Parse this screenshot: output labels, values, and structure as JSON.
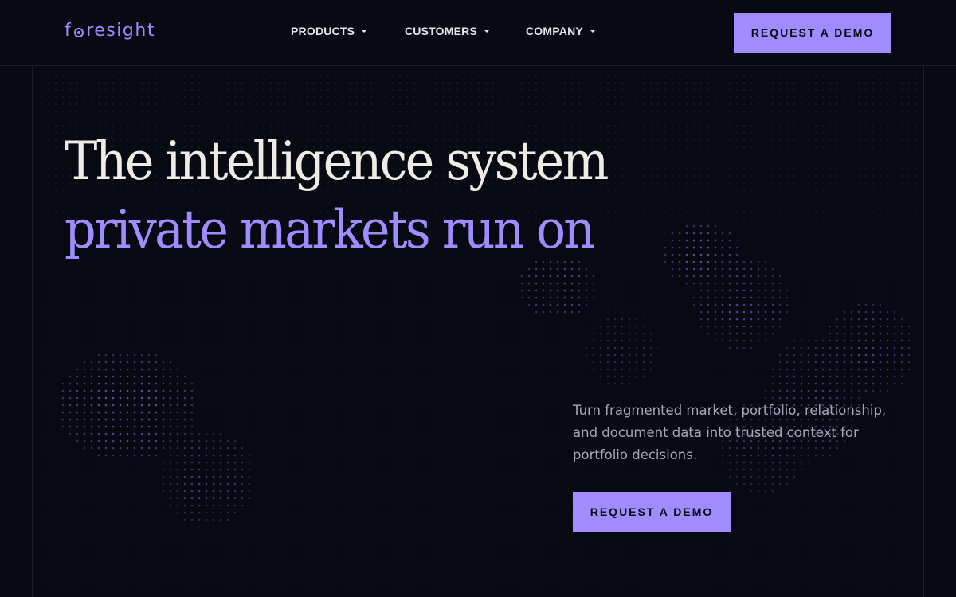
{
  "brand": {
    "logo_a": "f",
    "logo_b": "resight",
    "accent": "#a08cff"
  },
  "nav": {
    "items": [
      {
        "label": "PRODUCTS"
      },
      {
        "label": "CUSTOMERS"
      },
      {
        "label": "COMPANY"
      }
    ]
  },
  "header": {
    "cta_label": "REQUEST A DEMO"
  },
  "hero": {
    "title_line1": "The intelligence system",
    "title_line2": "private markets run on",
    "description": "Turn fragmented market, portfolio, relationship, and document data into trusted context for portfolio decisions.",
    "cta_label": "REQUEST A DEMO"
  },
  "colors": {
    "background": "#080a13",
    "title_primary": "#efece6",
    "title_accent": "#a18cff",
    "body_text": "#a7a6b6"
  }
}
